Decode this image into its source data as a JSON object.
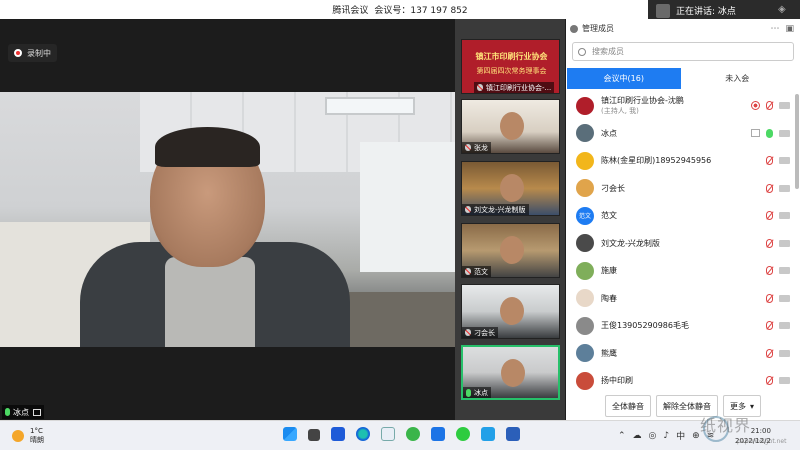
{
  "window": {
    "app_name": "腾讯会议",
    "meeting_id_label": "会议号：137 197 852"
  },
  "speaking": {
    "label": "正在讲话: 冰点"
  },
  "recording": {
    "label": "录制中"
  },
  "main_video": {
    "speaker_name": "冰点"
  },
  "thumbnails": [
    {
      "title_line1": "镇江市印刷行业协会",
      "title_line2": "第四届四次常务理事会",
      "caption": "镇江印刷行业协会-..."
    },
    {
      "caption": "张龙"
    },
    {
      "caption": "刘文龙-兴龙制版"
    },
    {
      "caption": "范文"
    },
    {
      "caption": "刁会长"
    },
    {
      "caption": "冰点"
    }
  ],
  "panel": {
    "title": "管理成员",
    "search_placeholder": "搜索成员",
    "tabs": [
      {
        "label": "会议中(16)",
        "active": true
      },
      {
        "label": "未入会",
        "active": false
      }
    ],
    "members": [
      {
        "name": "镇江印刷行业协会-沈鹏",
        "sub": "(主持人, 我)",
        "avatar_color": "#b01e2a",
        "status": "recording"
      },
      {
        "name": "冰点",
        "sub": "",
        "avatar_color": "#5a6e7a",
        "status": "speaking"
      },
      {
        "name": "陈林(金星印刷)18952945956",
        "sub": "",
        "avatar_color": "#f2b61b",
        "status": "muted"
      },
      {
        "name": "刁会长",
        "sub": "",
        "avatar_color": "#e0a44b",
        "status": "muted"
      },
      {
        "name": "范文",
        "sub": "",
        "avatar_color": "#1e7cf2",
        "avatar_text": "范文",
        "status": "muted"
      },
      {
        "name": "刘文龙-兴龙制版",
        "sub": "",
        "avatar_color": "#4a4a4a",
        "status": "muted"
      },
      {
        "name": "施康",
        "sub": "",
        "avatar_color": "#7fae5a",
        "status": "muted"
      },
      {
        "name": "陶春",
        "sub": "",
        "avatar_color": "#e8d8c8",
        "status": "muted"
      },
      {
        "name": "王俊13905290986毛毛",
        "sub": "",
        "avatar_color": "#8a8a8a",
        "status": "muted"
      },
      {
        "name": "熊鹰",
        "sub": "",
        "avatar_color": "#5d7f9a",
        "status": "muted"
      },
      {
        "name": "扬中印刷",
        "sub": "",
        "avatar_color": "#c94c3a",
        "status": "muted"
      }
    ],
    "buttons": {
      "mute_all": "全体静音",
      "unmute_all": "解除全体静音",
      "more": "更多"
    }
  },
  "taskbar": {
    "weather_temp": "1°C",
    "weather_desc": "晴朗",
    "tray_ime": "中",
    "tray_ime2": "⊕",
    "clock_time": "21:00",
    "clock_date": "2022/12/2"
  },
  "watermark": {
    "text": "纸视界",
    "url": "paperinsight.net"
  }
}
